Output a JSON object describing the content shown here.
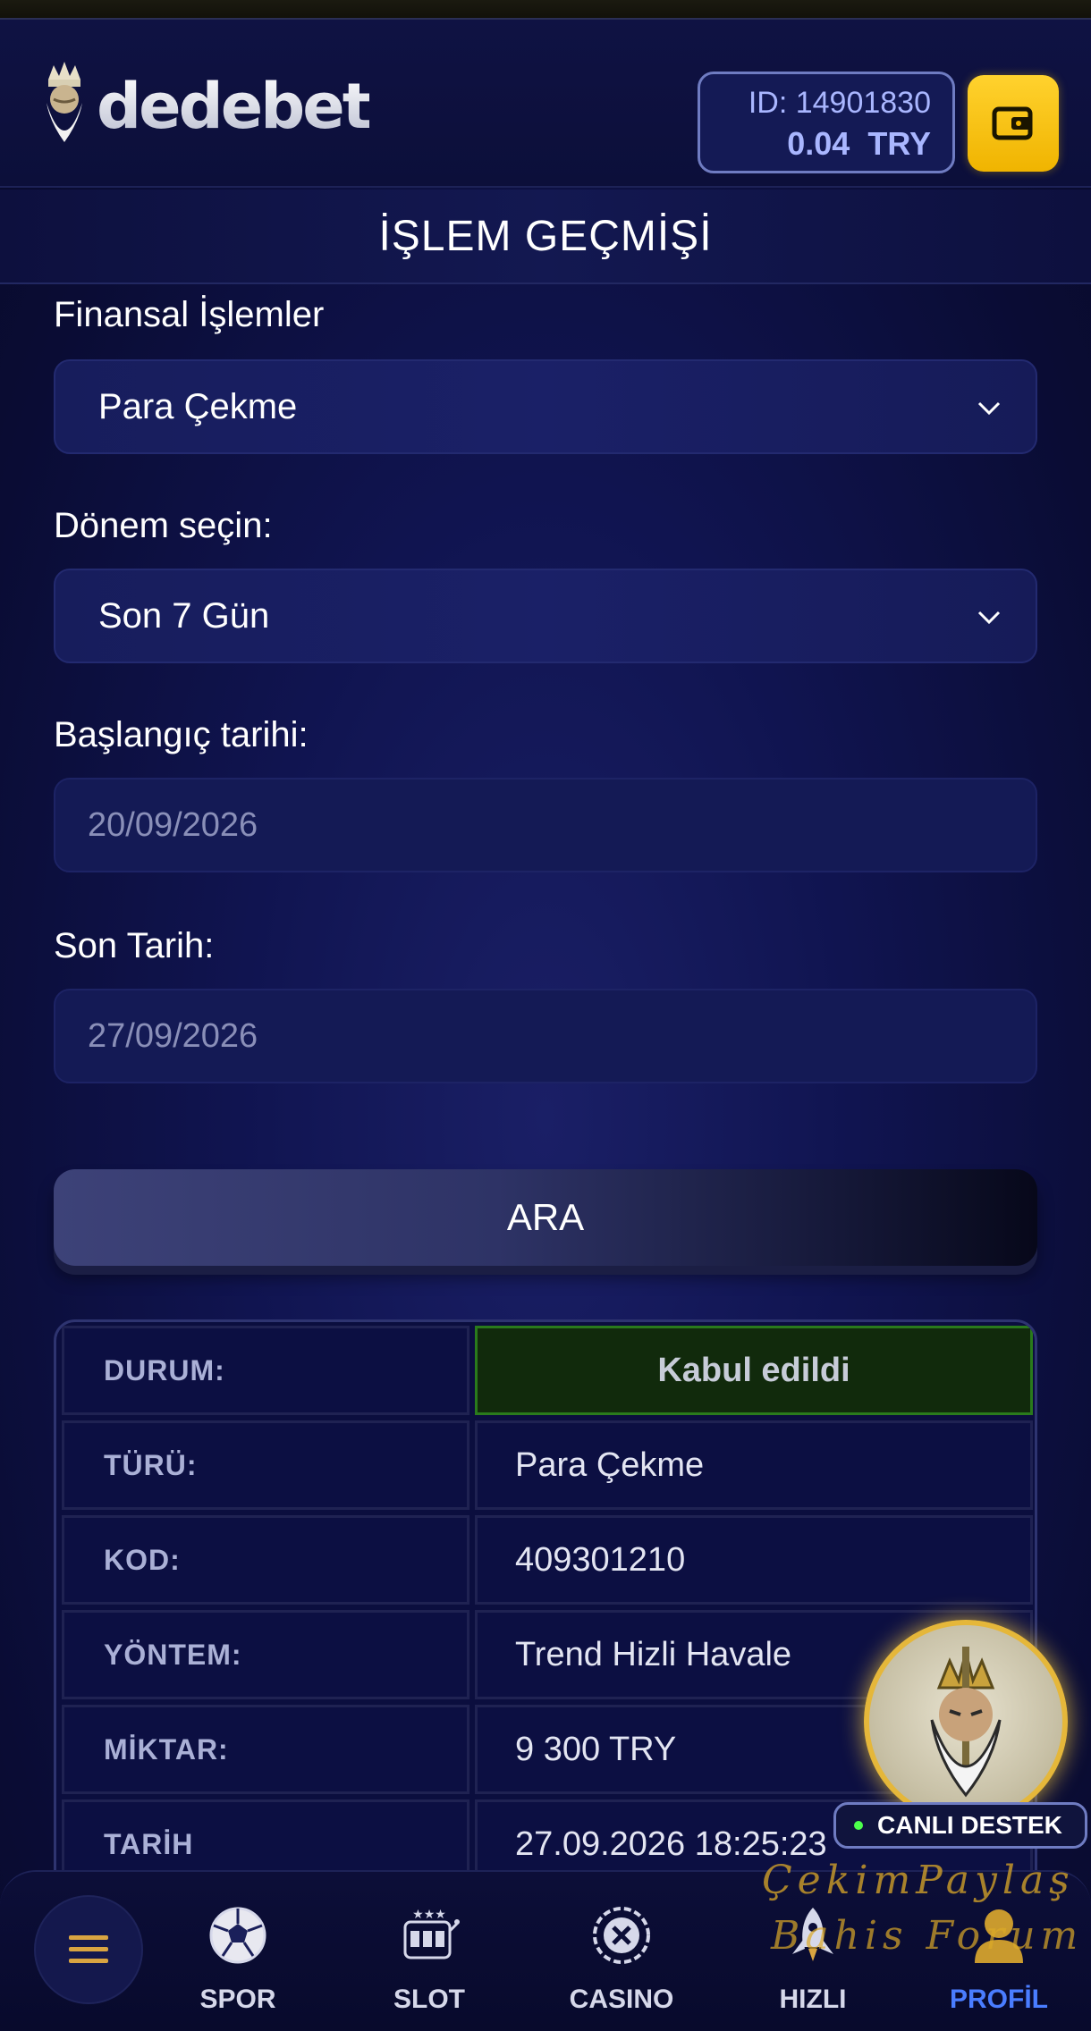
{
  "header": {
    "logo_text": "dedebet",
    "balance": {
      "id_label": "ID: 14901830",
      "amount": "0.04",
      "currency": "TRY"
    }
  },
  "page_title": "İŞLEM GEÇMİŞİ",
  "filters": {
    "financial_label": "Finansal İşlemler",
    "financial_value": "Para Çekme",
    "period_label": "Dönem seçin:",
    "period_value": "Son 7 Gün",
    "start_label": "Başlangıç tarihi:",
    "start_value": "20/09/2026",
    "end_label": "Son Tarih:",
    "end_value": "27/09/2026",
    "search_label": "ARA"
  },
  "result": {
    "rows": [
      {
        "key": "DURUM:",
        "value": "Kabul edildi"
      },
      {
        "key": "TÜRÜ:",
        "value": "Para Çekme"
      },
      {
        "key": "KOD:",
        "value": "409301210"
      },
      {
        "key": "YÖNTEM:",
        "value": "Trend Hizli Havale"
      },
      {
        "key": "MİKTAR:",
        "value": "9 300 TRY"
      },
      {
        "key": "TARİH",
        "value": "27.09.2026 18:25:23"
      }
    ]
  },
  "support": {
    "label": "CANLI DESTEK"
  },
  "watermark": {
    "line1": "ÇekimPaylaş",
    "line2": "Bahis Forum"
  },
  "nav": {
    "items": [
      {
        "label": "SPOR",
        "icon": "soccer-ball-icon"
      },
      {
        "label": "SLOT",
        "icon": "slot-machine-icon"
      },
      {
        "label": "CASINO",
        "icon": "roulette-chip-icon"
      },
      {
        "label": "HIZLI",
        "icon": "rocket-icon"
      },
      {
        "label": "PROFİL",
        "icon": "user-icon"
      }
    ],
    "active": "PROFİL"
  },
  "colors": {
    "accent_yellow": "#f5c000",
    "status_green": "#2a7a1c",
    "active_nav": "#4a7dff"
  }
}
